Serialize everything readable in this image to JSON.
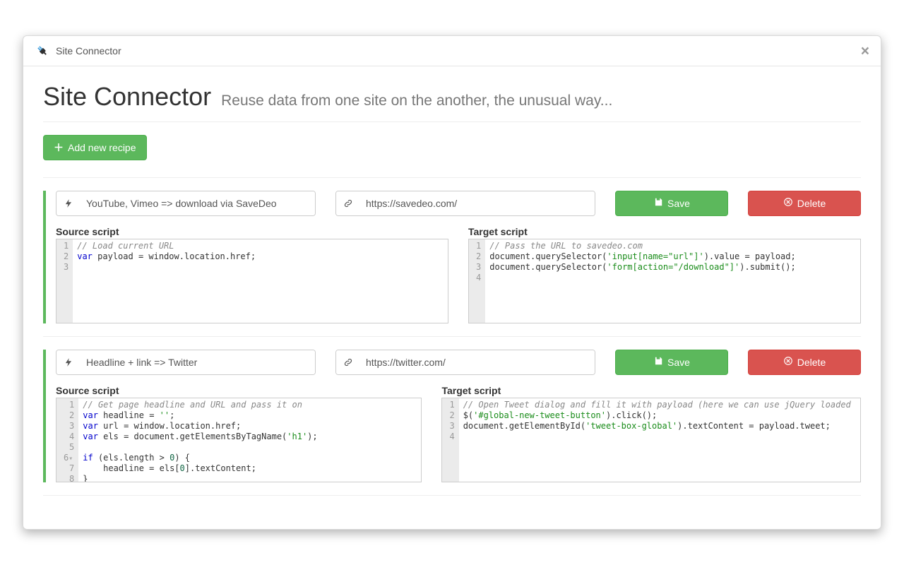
{
  "header": {
    "app_name": "Site Connector"
  },
  "page": {
    "title": "Site Connector",
    "subtitle": "Reuse data from one site on the another, the unusual way..."
  },
  "actions": {
    "add_recipe": "Add new recipe",
    "save": "Save",
    "delete": "Delete"
  },
  "labels": {
    "source_script": "Source script",
    "target_script": "Target script"
  },
  "recipes": [
    {
      "name": "YouTube, Vimeo => download via SaveDeo",
      "target_url": "https://savedeo.com/",
      "source_lines": [
        "// Load current URL",
        "var payload = window.location.href;",
        ""
      ],
      "target_lines": [
        "// Pass the URL to savedeo.com",
        "document.querySelector('input[name=\"url\"]').value = payload;",
        "document.querySelector('form[action=\"/download\"]').submit();",
        ""
      ]
    },
    {
      "name": "Headline + link => Twitter",
      "target_url": "https://twitter.com/",
      "source_lines": [
        "// Get page headline and URL and pass it on",
        "var headline = '';",
        "var url = window.location.href;",
        "var els = document.getElementsByTagName('h1');",
        "",
        "if (els.length > 0) {",
        "    headline = els[0].textContent;",
        "}",
        ""
      ],
      "target_lines": [
        "// Open Tweet dialog and fill it with payload (here we can use jQuery loaded ",
        "$('#global-new-tweet-button').click();",
        "document.getElementById('tweet-box-global').textContent = payload.tweet;",
        ""
      ]
    }
  ]
}
